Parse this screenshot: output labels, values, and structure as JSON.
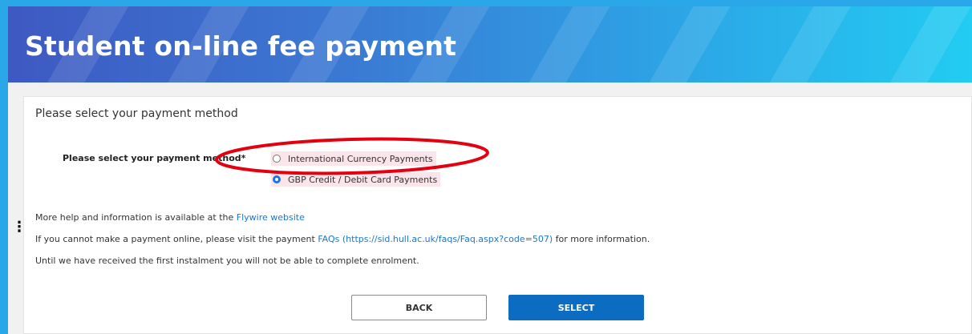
{
  "header": {
    "title": "Student on-line fee payment"
  },
  "form": {
    "section_title": "Please select your payment method",
    "field_label": "Please select your payment method*",
    "options": [
      {
        "label": "International Currency Payments",
        "selected": false
      },
      {
        "label": "GBP Credit / Debit Card Payments",
        "selected": true
      }
    ]
  },
  "info": {
    "line1_prefix": "More help and information is available at the ",
    "line1_link": "Flywire website",
    "line2_prefix": "If you cannot make a payment online, please visit the payment ",
    "line2_link": "FAQs (https://sid.hull.ac.uk/faqs/Faq.aspx?code=507)",
    "line2_suffix": " for more information.",
    "line3": "Until we have received the first instalment you will not be able to complete enrolment."
  },
  "buttons": {
    "back": "BACK",
    "select": "SELECT"
  },
  "colors": {
    "accent": "#0b6cc1",
    "link": "#1f75c8",
    "annotation": "#e3000f",
    "highlight": "#fbe4ea"
  },
  "icons": {
    "side_handle": "vertical-ellipsis-icon"
  }
}
